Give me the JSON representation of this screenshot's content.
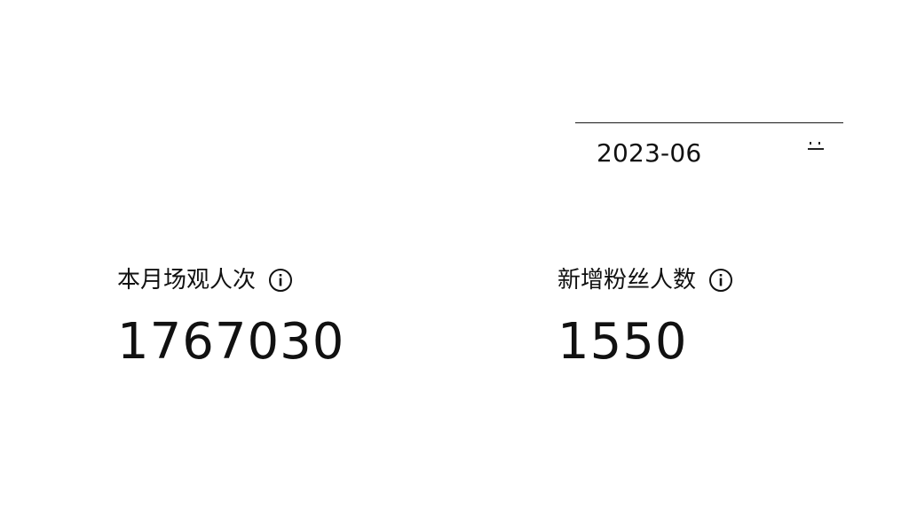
{
  "month_picker": {
    "value": "2023-06",
    "icon": "calendar-icon"
  },
  "stats": [
    {
      "label": "本月场观人次",
      "value": "1767030",
      "icon": "info-icon"
    },
    {
      "label": "新增粉丝人数",
      "value": "1550",
      "icon": "info-icon"
    }
  ]
}
